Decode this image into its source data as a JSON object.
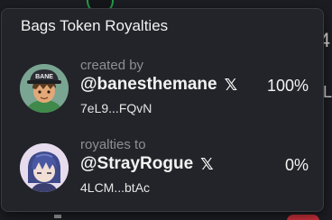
{
  "popover": {
    "title": "Bags Token Royalties",
    "entries": [
      {
        "role": "created by",
        "handle": "@banesthemane",
        "social_icon": "x-logo-icon",
        "address": "7eL9...FQvN",
        "percent": "100%",
        "avatar": "cartoon-character-with-bane-cap",
        "avatar_text": "BANE"
      },
      {
        "role": "royalties to",
        "handle": "@StrayRogue",
        "social_icon": "x-logo-icon",
        "address": "4LCM...btAc",
        "percent": "0%",
        "avatar": "anime-character-blue-hair"
      }
    ]
  },
  "background": {
    "right_glyph_top": "4",
    "right_glyph_mid": "L"
  },
  "colors": {
    "popover_bg": "#232429",
    "muted_text": "#8e8f96",
    "accent_green": "#22a04a",
    "badge_red": "#c8303a"
  }
}
